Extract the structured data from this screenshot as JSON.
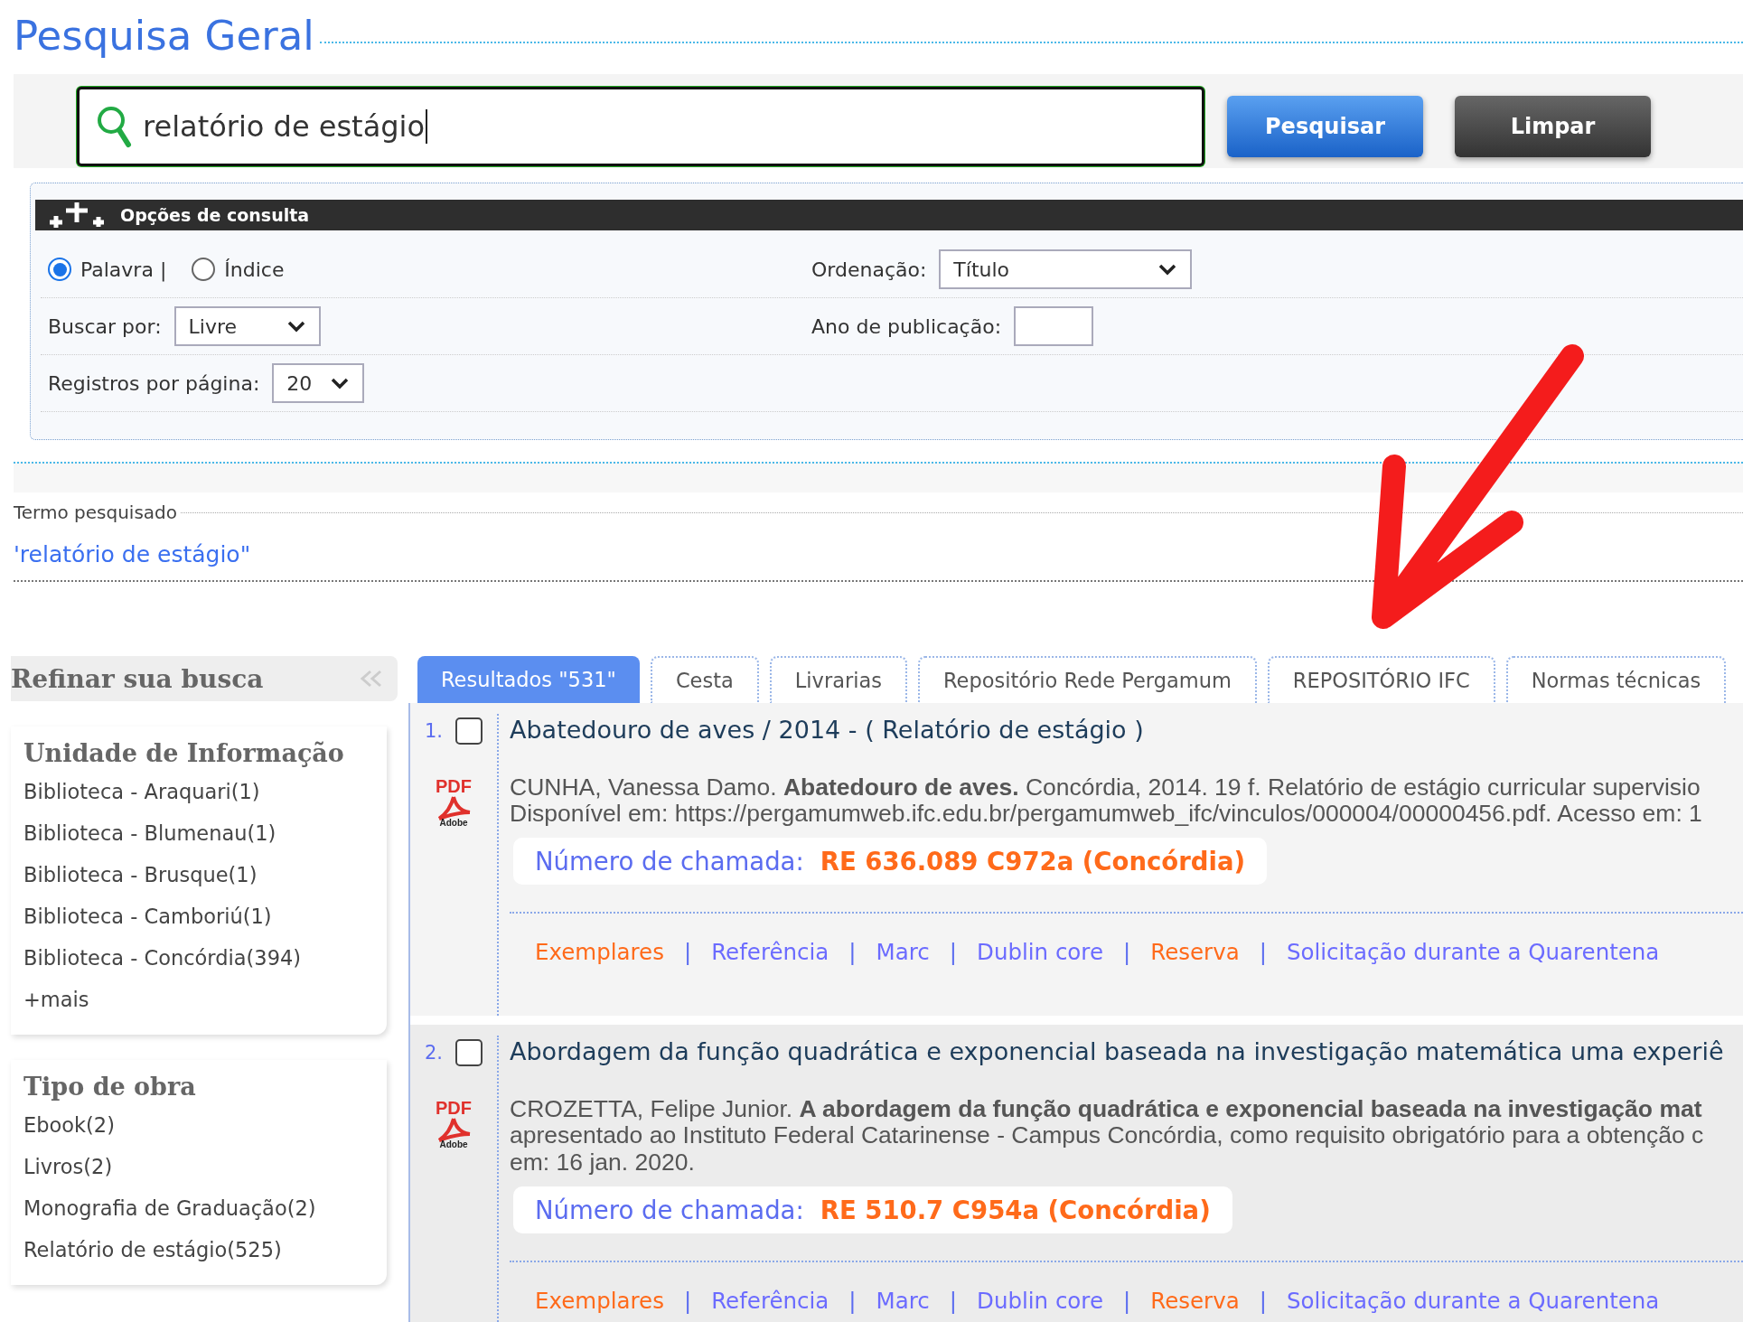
{
  "page_title": "Pesquisa Geral",
  "search": {
    "value": "relatório de estágio",
    "buttons": [
      {
        "label": "Pesquisar",
        "kind": "primary"
      },
      {
        "label": "Limpar",
        "kind": "secondary"
      }
    ]
  },
  "options": {
    "title": "Opções de consulta",
    "modes": [
      {
        "label": "Palavra |",
        "selected": true
      },
      {
        "label": "Índice",
        "selected": false
      }
    ],
    "sort": {
      "label": "Ordenação:",
      "value": "Título"
    },
    "search_by": {
      "label": "Buscar por:",
      "value": "Livre"
    },
    "year": {
      "label": "Ano de publicação:"
    },
    "per_page": {
      "label": "Registros por página:",
      "value": "20"
    }
  },
  "searched_term": {
    "label": "Termo pesquisado",
    "value": "'relatório de estágio\""
  },
  "sidebar": {
    "title": "Refinar sua busca",
    "groups": [
      {
        "title": "Unidade de Informação",
        "items": [
          "Biblioteca - Araquari(1)",
          "Biblioteca - Blumenau(1)",
          "Biblioteca - Brusque(1)",
          "Biblioteca - Camboriú(1)",
          "Biblioteca - Concórdia(394)",
          "+mais"
        ]
      },
      {
        "title": "Tipo de obra",
        "items": [
          "Ebook(2)",
          "Livros(2)",
          "Monografia de Graduação(2)",
          "Relatório de estágio(525)"
        ]
      }
    ]
  },
  "tabs": [
    {
      "label": "Resultados \"531\"",
      "selected": true
    },
    {
      "label": "Cesta",
      "selected": false
    },
    {
      "label": "Livrarias",
      "selected": false
    },
    {
      "label": "Repositório Rede Pergamum",
      "selected": false
    },
    {
      "label": "REPOSITÓRIO IFC",
      "selected": false
    },
    {
      "label": "Normas técnicas",
      "selected": false
    }
  ],
  "results": [
    {
      "number": "1.",
      "checked": false,
      "icon_label": "PDF",
      "icon_caption": "Adobe",
      "title": "Abatedouro de aves / 2014 - ( Relatório de estágio )",
      "lines": [
        "CUNHA, Vanessa Damo. **Abatedouro de aves.** Concórdia, 2014. 19 f. Relatório de estágio curricular supervisio",
        "Disponível em: https://pergamumweb.ifc.edu.br/pergamumweb_ifc/vinculos/000004/00000456.pdf. Acesso em: 1"
      ],
      "call_label": "Número de chamada:",
      "call_number": "RE 636.089 C972a (Concórdia)",
      "separator": "|",
      "links": [
        {
          "label": "Exemplares",
          "color": "#ff6a1a"
        },
        {
          "label": "Referência",
          "color": "#6b6bff"
        },
        {
          "label": "Marc",
          "color": "#6b6bff"
        },
        {
          "label": "Dublin core",
          "color": "#6b6bff"
        },
        {
          "label": "Reserva",
          "color": "#ff6a1a"
        },
        {
          "label": "Solicitação durante a Quarentena",
          "color": "#6b6bff"
        }
      ]
    },
    {
      "number": "2.",
      "checked": false,
      "icon_label": "PDF",
      "icon_caption": "Adobe",
      "title": "Abordagem da função quadrática e exponencial baseada na investigação matemática uma experiê",
      "lines": [
        "CROZETTA, Felipe Junior. **A abordagem da função quadrática e exponencial baseada na investigação mat**",
        "apresentado ao Instituto Federal Catarinense - Campus Concórdia, como requisito obrigatório para a obtenção c",
        "em: 16 jan. 2020."
      ],
      "call_label": "Número de chamada:",
      "call_number": "RE 510.7 C954a (Concórdia)",
      "separator": "|",
      "links": [
        {
          "label": "Exemplares",
          "color": "#ff6a1a"
        },
        {
          "label": "Referência",
          "color": "#6b6bff"
        },
        {
          "label": "Marc",
          "color": "#6b6bff"
        },
        {
          "label": "Dublin core",
          "color": "#6b6bff"
        },
        {
          "label": "Reserva",
          "color": "#ff6a1a"
        },
        {
          "label": "Solicitação durante a Quarentena",
          "color": "#6b6bff"
        }
      ]
    }
  ]
}
